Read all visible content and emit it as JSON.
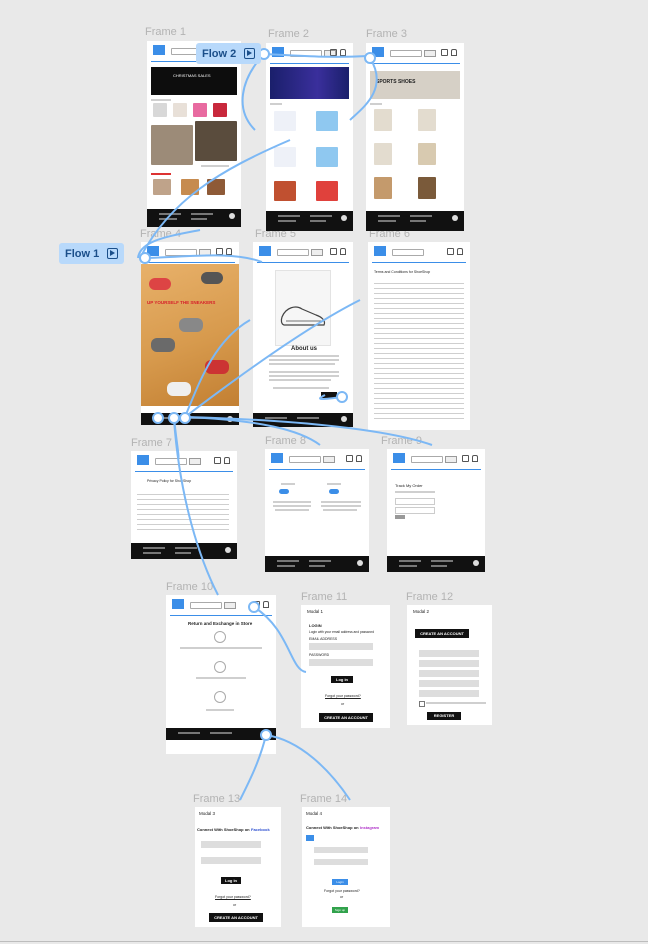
{
  "frames": {
    "f1": "Frame 1",
    "f2": "Frame 2",
    "f3": "Frame 3",
    "f4": "Frame 4",
    "f5": "Frame 5",
    "f6": "Frame 6",
    "f7": "Frame 7",
    "f8": "Frame 8",
    "f9": "Frame 9",
    "f10": "Frame 10",
    "f11": "Frame 11",
    "f12": "Frame 12",
    "f13": "Frame 13",
    "f14": "Frame 14"
  },
  "flows": {
    "flow1": "Flow 1",
    "flow2": "Flow 2"
  },
  "content": {
    "f1_banner": "CHRISTMAS SALES",
    "f3_banner": "SPORTS SHOES",
    "f4_banner": "UP YOURSELF THE SNEAKERS",
    "f5_title": "About us",
    "f6_title": "Terms and Conditions for ShoeShop",
    "f7_title": "Privacy Policy for ShoeShop",
    "f9_title": "Track My Order",
    "f10_title": "Return and Exchange in Store",
    "f11_modal": "Modal 1",
    "f11_login": "LOGIN",
    "f11_sub": "Login with your email address and password",
    "f11_email": "EMAIL ADDRESS",
    "f11_password": "PASSWORD",
    "f11_loginbtn": "Log in",
    "f11_forgot": "Forgot your password?",
    "f11_or": "or",
    "f11_create": "CREATE AN ACCOUNT",
    "f12_modal": "Modal 2",
    "f12_create": "CREATE AN ACCOUNT",
    "f12_register": "REGISTER",
    "f13_modal": "Modal 3",
    "f13_connect": "Connect With ShoeShop on",
    "f13_brand": "Facebook",
    "f13_login": "Log in",
    "f13_forgot": "Forgot your password?",
    "f13_or": "or",
    "f13_create": "CREATE AN ACCOUNT",
    "f14_modal": "Modal 4",
    "f14_connect": "Connect With ShoeShop on",
    "f14_brand": "Instagram",
    "f14_login": "Login",
    "f14_forgot": "Forgot your password?",
    "f14_or": "or",
    "f14_signup": "Sign up"
  },
  "colors": {
    "accent": "#3b8ee8",
    "flow": "#b8d9fb",
    "connector": "#7cb8f5",
    "canvas": "#e9e9e9"
  }
}
